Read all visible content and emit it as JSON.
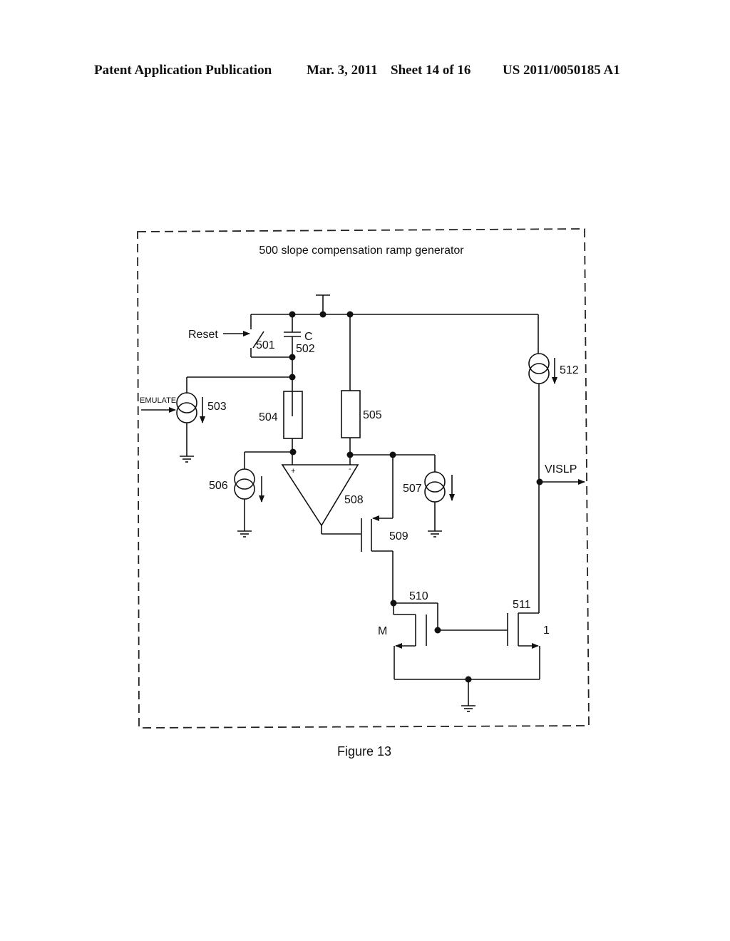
{
  "header": {
    "publication": "Patent Application Publication",
    "date": "Mar. 3, 2011",
    "sheet": "Sheet 14 of 16",
    "number": "US 2011/0050185 A1"
  },
  "figure": {
    "title": "500 slope compensation ramp generator",
    "caption": "Figure 13",
    "labels": {
      "reset": "Reset",
      "switch": "501",
      "cap_name": "C",
      "cap": "502",
      "emulate": "EMULATE",
      "src503": "503",
      "res504": "504",
      "res505": "505",
      "src506": "506",
      "src507": "507",
      "amp": "508",
      "plus": "+",
      "minus": "-",
      "fet509": "509",
      "fet510": "510",
      "fet511": "511",
      "ratio_m": "M",
      "ratio_1": "1",
      "src512": "512",
      "output": "VISLP"
    }
  }
}
